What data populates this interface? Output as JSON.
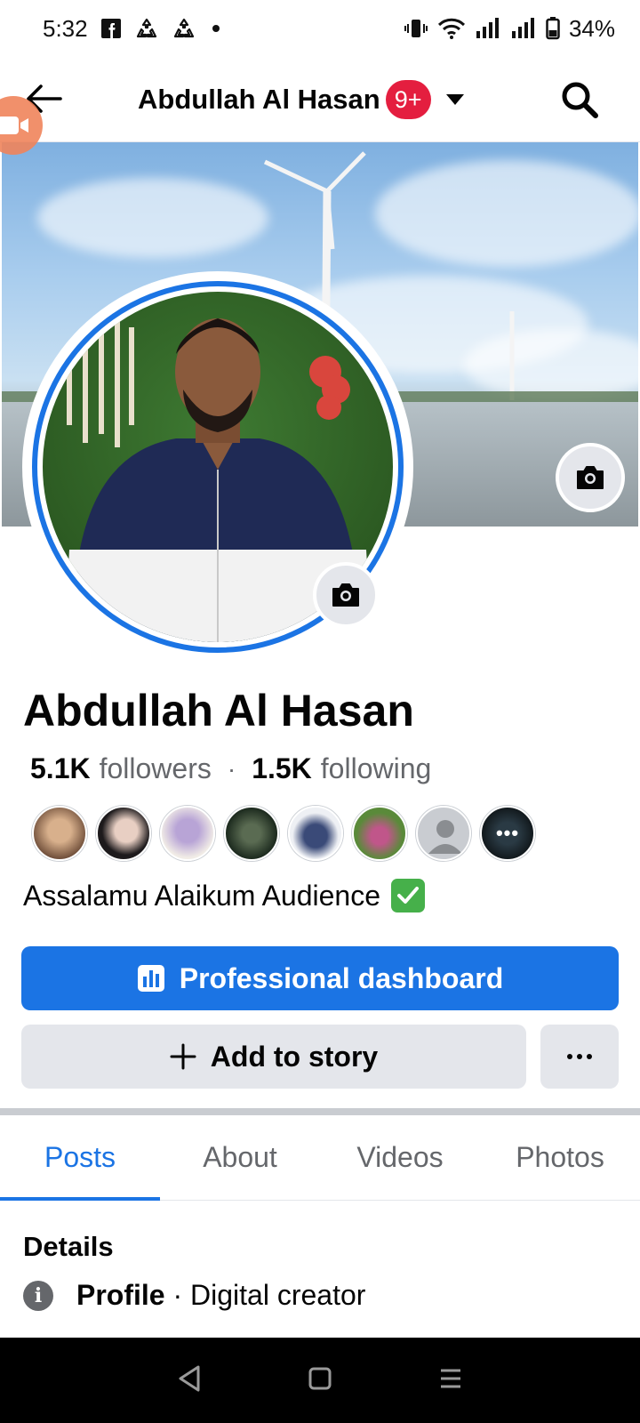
{
  "status_bar": {
    "time": "5:32",
    "battery": "34%",
    "icons": [
      "facebook-icon",
      "recycle-icon",
      "recycle-icon",
      "dot-icon",
      "vibrate-icon",
      "wifi-icon",
      "signal-icon",
      "signal-icon",
      "battery-icon"
    ]
  },
  "nav": {
    "title": "Abdullah Al Hasan",
    "badge": "9+",
    "icons": [
      "back-arrow-icon",
      "caret-down-icon",
      "search-icon",
      "video-call-icon"
    ]
  },
  "profile": {
    "name": "Abdullah Al Hasan",
    "followers_count": "5.1K",
    "followers_label": "followers",
    "separator": "·",
    "following_count": "1.5K",
    "following_label": "following",
    "bio": "Assalamu Alaikum Audience",
    "bio_emoji": "check-mark-emoji",
    "friend_avatars": 7,
    "more_label": "•••"
  },
  "actions": {
    "dashboard_label": "Professional dashboard",
    "add_story_label": "Add to story",
    "more_label": "•••"
  },
  "tabs": [
    {
      "label": "Posts",
      "active": true
    },
    {
      "label": "About",
      "active": false
    },
    {
      "label": "Videos",
      "active": false
    },
    {
      "label": "Photos",
      "active": false
    }
  ],
  "details": {
    "title": "Details",
    "row_bold": "Profile",
    "row_sep": "·",
    "row_text": "Digital creator"
  },
  "colors": {
    "accent": "#1b74e4",
    "badge": "#e41e3f",
    "button_gray": "#e4e6eb",
    "muted_text": "#65676b"
  }
}
